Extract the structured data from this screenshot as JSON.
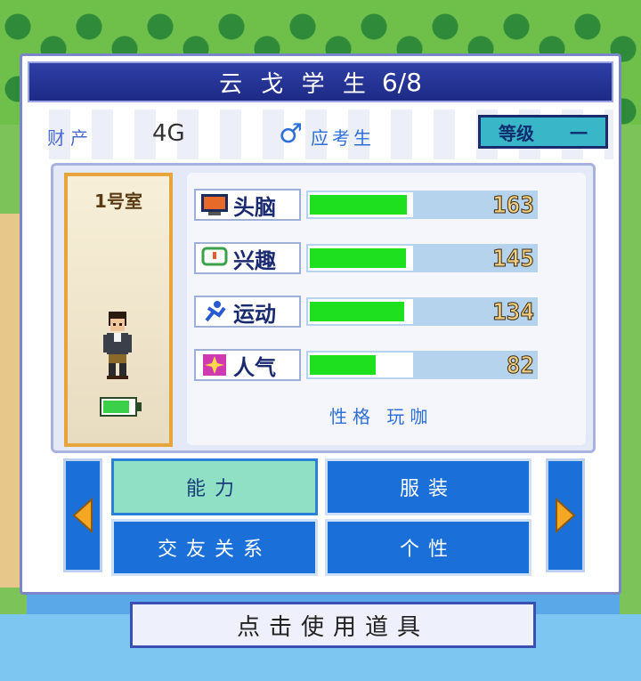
{
  "panel": {
    "title": "云 戈 学 生",
    "count": "6/8"
  },
  "info": {
    "asset_label": "财产",
    "asset_value": "4G",
    "gender_icon": "male-symbol-icon",
    "role": "应考生",
    "grade_label": "等级",
    "grade_value": "一"
  },
  "room": {
    "label": "1号室",
    "battery_level": 0.85
  },
  "stats": [
    {
      "name": "头脑",
      "icon": "brain-monitor-icon",
      "value": "163",
      "fill": 0.96
    },
    {
      "name": "兴趣",
      "icon": "speech-bubble-icon",
      "value": "145",
      "fill": 0.95
    },
    {
      "name": "运动",
      "icon": "running-icon",
      "value": "134",
      "fill": 0.93
    },
    {
      "name": "人气",
      "icon": "sparkle-icon",
      "value": "82",
      "fill": 0.65
    }
  ],
  "personality": "性格 玩咖",
  "tabs": {
    "ability": "能力",
    "clothing": "服装",
    "friends": "交友关系",
    "personality": "个性"
  },
  "use_item": "点击使用道具",
  "colors": {
    "accent_blue": "#1b6fd8",
    "active_tab": "#8fe0c4",
    "bar_green": "#1ee01e",
    "title_bar": "#1d2a86"
  }
}
